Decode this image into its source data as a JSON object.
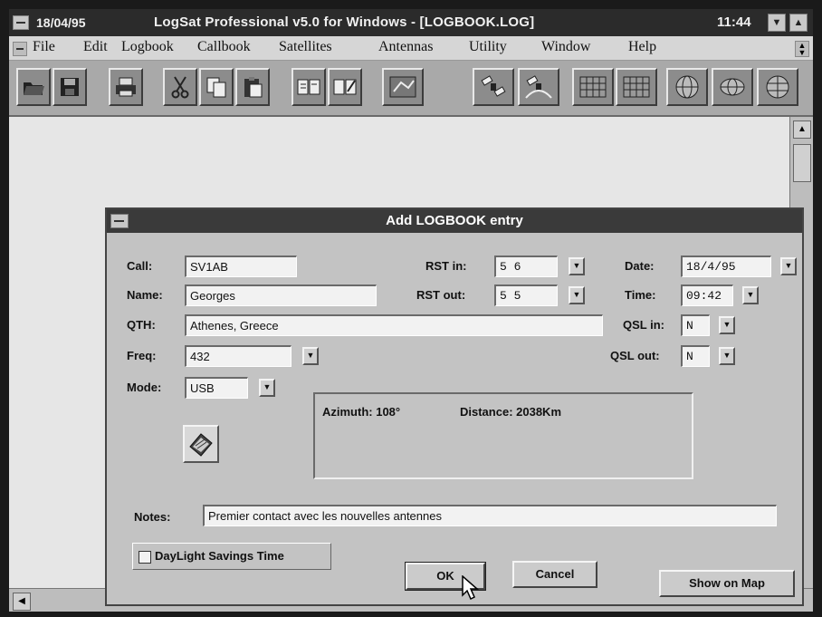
{
  "window": {
    "date": "18/04/95",
    "title": "LogSat Professional v5.0 for Windows - [LOGBOOK.LOG]",
    "clock": "11:44"
  },
  "menu": [
    "File",
    "Edit",
    "Logbook",
    "Callbook",
    "Satellites",
    "Antennas",
    "Utility",
    "Window",
    "Help"
  ],
  "dialog": {
    "title": "Add LOGBOOK entry",
    "labels": {
      "call": "Call:",
      "name": "Name:",
      "qth": "QTH:",
      "freq": "Freq:",
      "mode": "Mode:",
      "rst_in": "RST in:",
      "rst_out": "RST out:",
      "date": "Date:",
      "time": "Time:",
      "qsl_in": "QSL in:",
      "qsl_out": "QSL out:",
      "notes": "Notes:"
    },
    "values": {
      "call": "SV1AB",
      "name": "Georges",
      "qth": "Athenes, Greece",
      "freq": "432",
      "mode": "USB",
      "rst_in": "5 6",
      "rst_out": "5 5",
      "date": "18/4/95",
      "time": "09:42",
      "qsl_in": "N",
      "qsl_out": "N",
      "notes": "Premier contact avec les nouvelles antennes"
    },
    "azimuth": "Azimuth: 108°",
    "distance": "Distance: 2038Km",
    "daylight_label": "DayLight Savings Time",
    "daylight_checked": false,
    "buttons": {
      "ok": "OK",
      "cancel": "Cancel",
      "map": "Show on Map"
    }
  },
  "icons": [
    "open-folder-icon",
    "save-disk-icon",
    "print-icon",
    "cut-icon",
    "copy-icon",
    "paste-icon",
    "logbook-icon",
    "logbook-edit-icon",
    "satellite-map-icon",
    "satellite-icon",
    "satellite-track-icon",
    "grid-icon",
    "grid-icon",
    "globe-icon",
    "globe-icon",
    "globe-icon"
  ]
}
